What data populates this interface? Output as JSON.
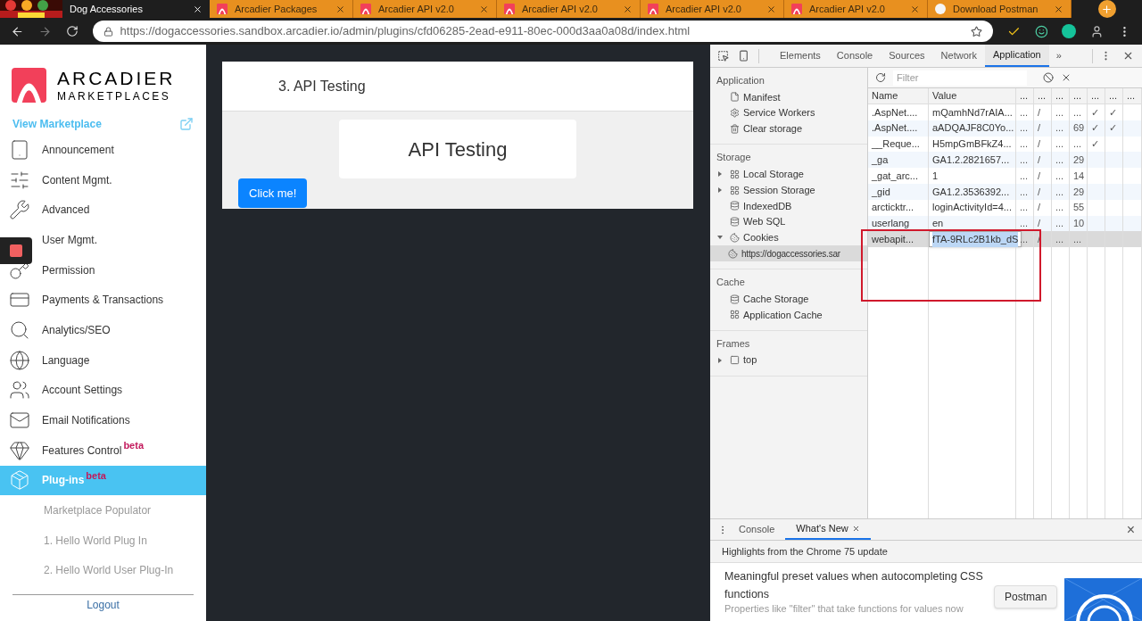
{
  "browser": {
    "tabs": [
      {
        "title": "Dog Accessories",
        "selected": true,
        "kind": "site"
      },
      {
        "title": "Arcadier Packages",
        "selected": false,
        "kind": "arcadier"
      },
      {
        "title": "Arcadier API v2.0",
        "selected": false,
        "kind": "arcadier"
      },
      {
        "title": "Arcadier API v2.0",
        "selected": false,
        "kind": "arcadier"
      },
      {
        "title": "Arcadier API v2.0",
        "selected": false,
        "kind": "arcadier"
      },
      {
        "title": "Arcadier API v2.0",
        "selected": false,
        "kind": "arcadier"
      },
      {
        "title": "Download Postman",
        "selected": false,
        "kind": "postman"
      }
    ],
    "url": "https://dogaccessories.sandbox.arcadier.io/admin/plugins/cfd06285-2ead-e911-80ec-000d3aa0a08d/index.html"
  },
  "sidebar": {
    "brand": "ARCADIER",
    "brand_sub": "MARKETPLACES",
    "view_marketplace": "View Marketplace",
    "items": [
      {
        "label": "Announcement",
        "selected": false
      },
      {
        "label": "Content Mgmt.",
        "selected": false
      },
      {
        "label": "Advanced",
        "selected": false
      },
      {
        "label": "User Mgmt.",
        "selected": false
      },
      {
        "label": "Permission",
        "selected": false
      },
      {
        "label": "Payments & Transactions",
        "selected": false
      },
      {
        "label": "Analytics/SEO",
        "selected": false
      },
      {
        "label": "Language",
        "selected": false
      },
      {
        "label": "Account Settings",
        "selected": false
      },
      {
        "label": "Email Notifications",
        "selected": false
      },
      {
        "label": "Features Control",
        "badge": "beta",
        "selected": false
      },
      {
        "label": "Plug-ins",
        "badge": "beta",
        "selected": true
      }
    ],
    "sub_items": [
      "Marketplace Populator",
      "1. Hello World Plug In",
      "2. Hello World User Plug-In"
    ],
    "logout": "Logout"
  },
  "page": {
    "title": "3. API Testing",
    "heading": "API Testing",
    "button": "Click me!"
  },
  "devtools": {
    "tabs": [
      {
        "label": "Elements",
        "selected": false
      },
      {
        "label": "Console",
        "selected": false
      },
      {
        "label": "Sources",
        "selected": false
      },
      {
        "label": "Network",
        "selected": false
      },
      {
        "label": "Application",
        "selected": true
      }
    ],
    "more": "»",
    "sections": [
      {
        "title": "Application",
        "items": [
          {
            "label": "Manifest"
          },
          {
            "label": "Service Workers"
          },
          {
            "label": "Clear storage"
          }
        ]
      },
      {
        "title": "Storage",
        "items": [
          {
            "label": "Local Storage",
            "expanded": false
          },
          {
            "label": "Session Storage",
            "expanded": false
          },
          {
            "label": "IndexedDB"
          },
          {
            "label": "Web SQL"
          },
          {
            "label": "Cookies",
            "expanded": true,
            "children": [
              {
                "label": "https://dogaccessories.sar",
                "selected": true
              }
            ]
          }
        ]
      },
      {
        "title": "Cache",
        "items": [
          {
            "label": "Cache Storage"
          },
          {
            "label": "Application Cache"
          }
        ]
      },
      {
        "title": "Frames",
        "items": [
          {
            "label": "top",
            "expanded": false
          }
        ]
      }
    ],
    "filter_placeholder": "Filter",
    "columns": [
      "Name",
      "Value",
      "...",
      "...",
      "...",
      "...",
      "...",
      "...",
      "..."
    ],
    "rows": [
      {
        "selected": false,
        "cells": [
          ".AspNet....",
          "mQamhNd7rAIA...",
          "...",
          "/",
          "...",
          "...",
          "✓",
          "✓",
          null
        ]
      },
      {
        "selected": false,
        "cells": [
          ".AspNet....",
          "aADQAJF8C0Yo...",
          "...",
          "/",
          "...",
          "69",
          "✓",
          "✓",
          null
        ]
      },
      {
        "selected": false,
        "cells": [
          "__Reque...",
          "H5mpGmBFkZ4...",
          "...",
          "/",
          "...",
          "...",
          "✓",
          null,
          null
        ]
      },
      {
        "selected": false,
        "cells": [
          "_ga",
          "GA1.2.2821657...",
          "...",
          "/",
          "...",
          "29",
          null,
          null,
          null
        ]
      },
      {
        "selected": false,
        "cells": [
          "_gat_arc...",
          "1",
          "...",
          "/",
          "...",
          "14",
          null,
          null,
          null
        ]
      },
      {
        "selected": false,
        "cells": [
          "_gid",
          "GA1.2.3536392...",
          "...",
          "/",
          "...",
          "29",
          null,
          null,
          null
        ]
      },
      {
        "selected": false,
        "cells": [
          "arcticktr...",
          "loginActivityId=4...",
          "...",
          "/",
          "...",
          "55",
          null,
          null,
          null
        ]
      },
      {
        "selected": false,
        "cells": [
          "userlang",
          "en",
          "...",
          "/",
          "...",
          "10",
          null,
          null,
          null
        ]
      },
      {
        "selected": true,
        "cells": [
          "webapit...",
          "fTA-9RLc2B1kb_dS",
          "...",
          "/",
          "...",
          "...",
          null,
          null,
          null
        ]
      }
    ],
    "drawer": {
      "tabs": [
        {
          "label": "Console",
          "selected": false,
          "closable": false
        },
        {
          "label": "What's New",
          "selected": true,
          "closable": true
        }
      ],
      "close": "×",
      "highlights": "Highlights from the Chrome 75 update",
      "headline": "Meaningful preset values when autocompleting CSS functions",
      "body": "Properties like \"filter\" that take functions for values now"
    }
  },
  "tooltip": "Postman"
}
